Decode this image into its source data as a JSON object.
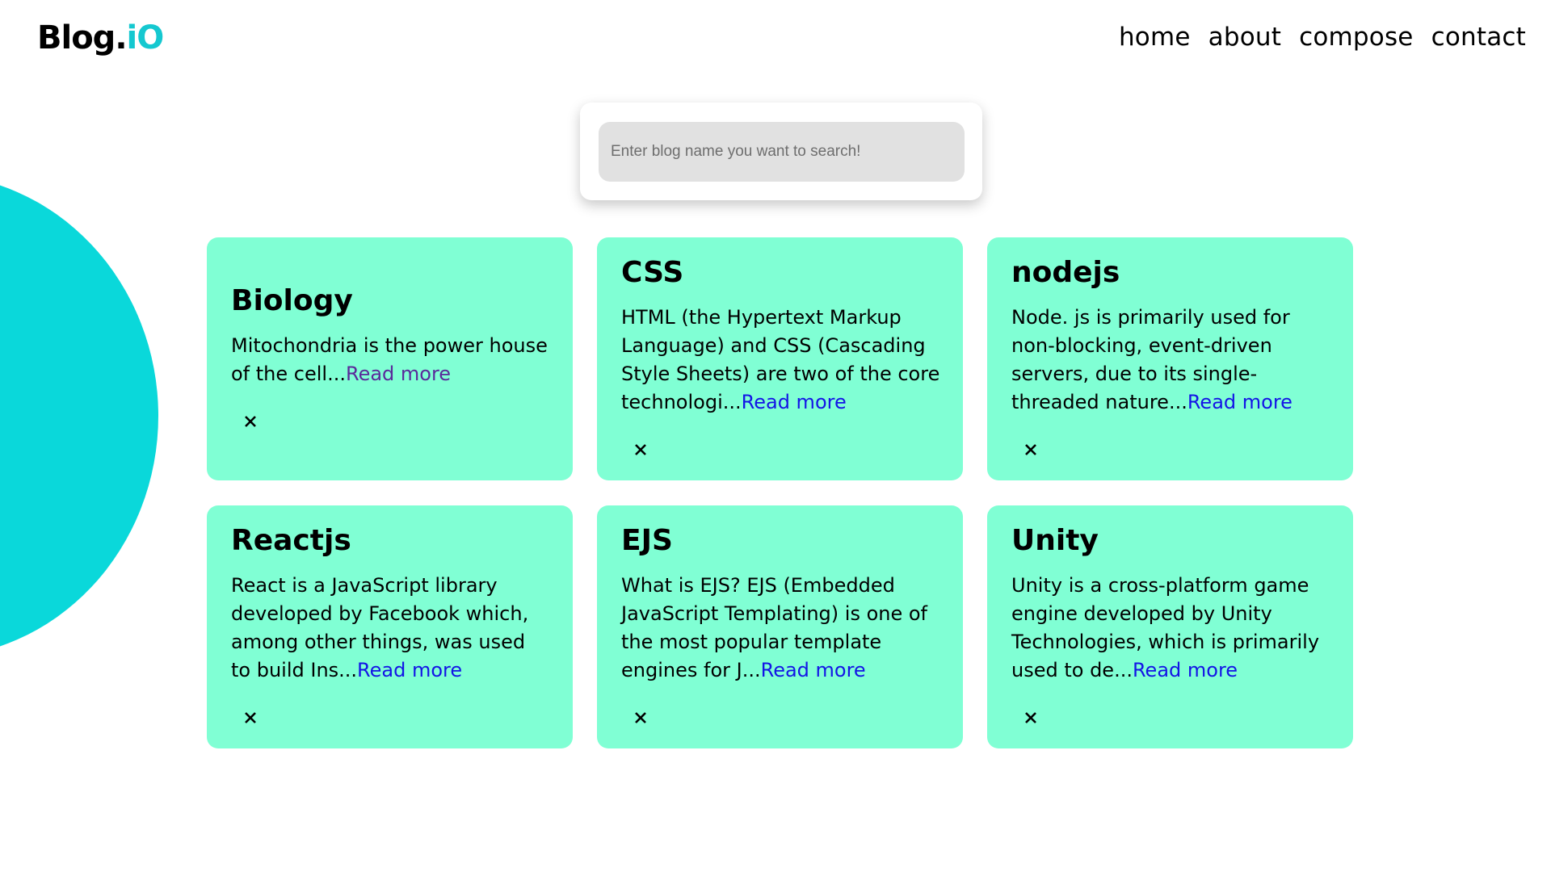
{
  "header": {
    "logo_main": "Blog.",
    "logo_accent": "iO",
    "nav": [
      "home",
      "about",
      "compose",
      "contact"
    ]
  },
  "search": {
    "placeholder": "Enter blog name you want to search!"
  },
  "colors": {
    "accent": "#15c8d0",
    "circle": "#0ad8da",
    "card": "#80ffd4",
    "link": "#1414e6",
    "link_visited": "#5a2a9a"
  },
  "posts": [
    {
      "title": "Biology",
      "excerpt": "Mitochondria is the power house of the cell...",
      "read_more": "Read more",
      "close_icon": "close-icon"
    },
    {
      "title": "CSS",
      "excerpt": "HTML (the Hypertext Markup Language) and CSS (Cascading Style Sheets) are two of the core technologi...",
      "read_more": "Read more",
      "close_icon": "close-icon"
    },
    {
      "title": "nodejs",
      "excerpt": "Node. js is primarily used for non-blocking, event-driven servers, due to its single-threaded nature...",
      "read_more": "Read more",
      "close_icon": "close-icon"
    },
    {
      "title": "Reactjs",
      "excerpt": "React is a JavaScript library developed by Facebook which, among other things, was used to build Ins...",
      "read_more": "Read more",
      "close_icon": "close-icon"
    },
    {
      "title": "EJS",
      "excerpt": "What is EJS? EJS (Embedded JavaScript Templating) is one of the most popular template engines for J...",
      "read_more": "Read more",
      "close_icon": "close-icon"
    },
    {
      "title": "Unity",
      "excerpt": "Unity is a cross-platform game engine developed by Unity Technologies, which is primarily used to de...",
      "read_more": "Read more",
      "close_icon": "close-icon"
    }
  ]
}
